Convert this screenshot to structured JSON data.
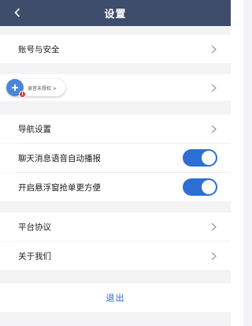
{
  "header": {
    "title": "设置"
  },
  "rows": {
    "account_security": "账号与安全",
    "profile_text": "录音未授权 >",
    "navigation_settings": "导航设置",
    "chat_voice_autoplay": "聊天消息语音自动播报",
    "floating_window": "开启悬浮窗抢单更方便",
    "platform_agreement": "平台协议",
    "about_us": "关于我们"
  },
  "toggles": {
    "chat_voice_autoplay": true,
    "floating_window": true
  },
  "logout_label": "退出",
  "colors": {
    "header_bg": "#3d4d6b",
    "accent": "#2e6fd6",
    "logout_text": "#2d66c4"
  },
  "icons": [
    "back-arrow-icon",
    "chevron-right-icon",
    "avatar-icon",
    "badge-dot"
  ]
}
